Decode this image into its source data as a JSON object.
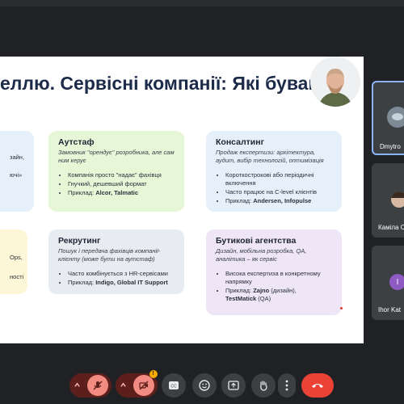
{
  "slide": {
    "title": "еллю. Сервісні компанії: Які бувають",
    "cards": [
      {
        "id": "left-top",
        "title": "",
        "subtitle": "",
        "items": [
          {
            "text": "зайн,"
          },
          {
            "text": ""
          },
          {
            "text": "ючі»"
          }
        ]
      },
      {
        "id": "outstaff",
        "title": "Аутстаф",
        "subtitle": "Замовник \"орендує\" розробника, але сам ним керує",
        "items": [
          {
            "text": "Компанія просто \"надає\" фахівця"
          },
          {
            "text": "Гнучкий, дешевший формат"
          },
          {
            "text": "Приклад: ",
            "bold": "Alcor, Talmatic"
          }
        ]
      },
      {
        "id": "consulting",
        "title": "Консалтинг",
        "subtitle": "Продаж експертизи: архітектура, аудит, вибір технологій, оптимізація",
        "items": [
          {
            "text": "Короткострокові або періодичні включення"
          },
          {
            "text": "Часто працює на C-level клієнтів"
          },
          {
            "text": "Приклад: ",
            "bold": "Andersen, Infopulse"
          }
        ]
      },
      {
        "id": "left-bottom",
        "title": "",
        "subtitle": "",
        "items": [
          {
            "text": "Ops,"
          },
          {
            "text": "ності"
          }
        ]
      },
      {
        "id": "recruiting",
        "title": "Рекрутинг",
        "subtitle": "Пошук і передача фахівців компанії-клієнту (може бути на аутстаф)",
        "items": [
          {
            "text": "Часто комбінується з HR-сервісами"
          },
          {
            "text": "Приклад: ",
            "bold": "Indigo, Global IT Support"
          }
        ]
      },
      {
        "id": "boutique",
        "title": "Бутикові агентства",
        "subtitle": "Дизайн, мобільна розробка, QA, аналітика – як сервіс",
        "items": [
          {
            "text": "Висока експертиза в конкретному напрямку"
          },
          {
            "text": "Приклад: ",
            "bold": "Zajno",
            "tail": " (дизайн),"
          },
          {
            "text": "",
            "bold": "TestMatick",
            "tail": " (QA)"
          }
        ]
      }
    ]
  },
  "participants": [
    {
      "name": "Dmytro"
    },
    {
      "name": "Каміла С"
    },
    {
      "name": "Ihor Kat",
      "initial": "I"
    }
  ],
  "colors": {
    "card_green": "#e6f7d8",
    "card_blue": "#e6f0fb",
    "card_yellow": "#fdf7d7",
    "card_gray": "#e8ebef",
    "card_purple": "#eee6f6",
    "end_call": "#ea4335",
    "avatar_purple": "#8e5bc2"
  }
}
